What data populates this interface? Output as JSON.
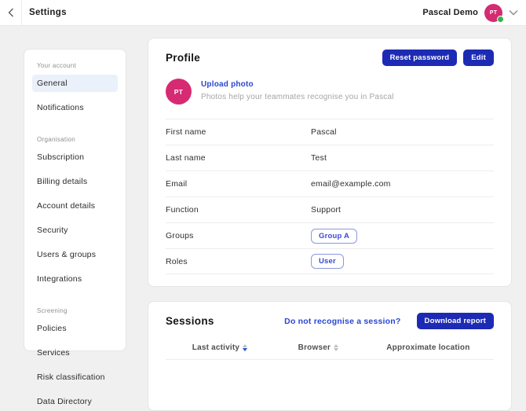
{
  "topbar": {
    "title": "Settings",
    "user": {
      "name": "Pascal Demo",
      "initials": "PT"
    }
  },
  "sidebar": {
    "sections": [
      {
        "label": "Your account",
        "items": [
          {
            "label": "General"
          },
          {
            "label": "Notifications"
          }
        ]
      },
      {
        "label": "Organisation",
        "items": [
          {
            "label": "Subscription"
          },
          {
            "label": "Billing details"
          },
          {
            "label": "Account details"
          },
          {
            "label": "Security"
          },
          {
            "label": "Users & groups"
          },
          {
            "label": "Integrations"
          }
        ]
      },
      {
        "label": "Screening",
        "items": [
          {
            "label": "Policies"
          },
          {
            "label": "Services"
          },
          {
            "label": "Risk classification"
          },
          {
            "label": "Data Directory"
          }
        ]
      }
    ]
  },
  "profile": {
    "title": "Profile",
    "reset_password_label": "Reset password",
    "edit_label": "Edit",
    "avatar_initials": "PT",
    "upload_photo_label": "Upload photo",
    "upload_photo_hint": "Photos help your teammates recognise you in Pascal",
    "fields": [
      {
        "label": "First name",
        "value": "Pascal"
      },
      {
        "label": "Last name",
        "value": "Test"
      },
      {
        "label": "Email",
        "value": "email@example.com"
      },
      {
        "label": "Function",
        "value": "Support"
      },
      {
        "label": "Groups",
        "chips": [
          "Group A"
        ]
      },
      {
        "label": "Roles",
        "chips": [
          "User"
        ]
      }
    ]
  },
  "sessions": {
    "title": "Sessions",
    "link_label": "Do not recognise a session?",
    "download_label": "Download report",
    "columns": [
      "Last activity",
      "Browser",
      "Approximate location"
    ]
  },
  "colors": {
    "accent_navy": "#1d2bb4",
    "link_blue": "#2946d2",
    "avatar_pink": "#d62a72",
    "status_green": "#33b24a",
    "active_item_bg": "#eaf1fa",
    "page_bg": "#f0f0f1"
  }
}
